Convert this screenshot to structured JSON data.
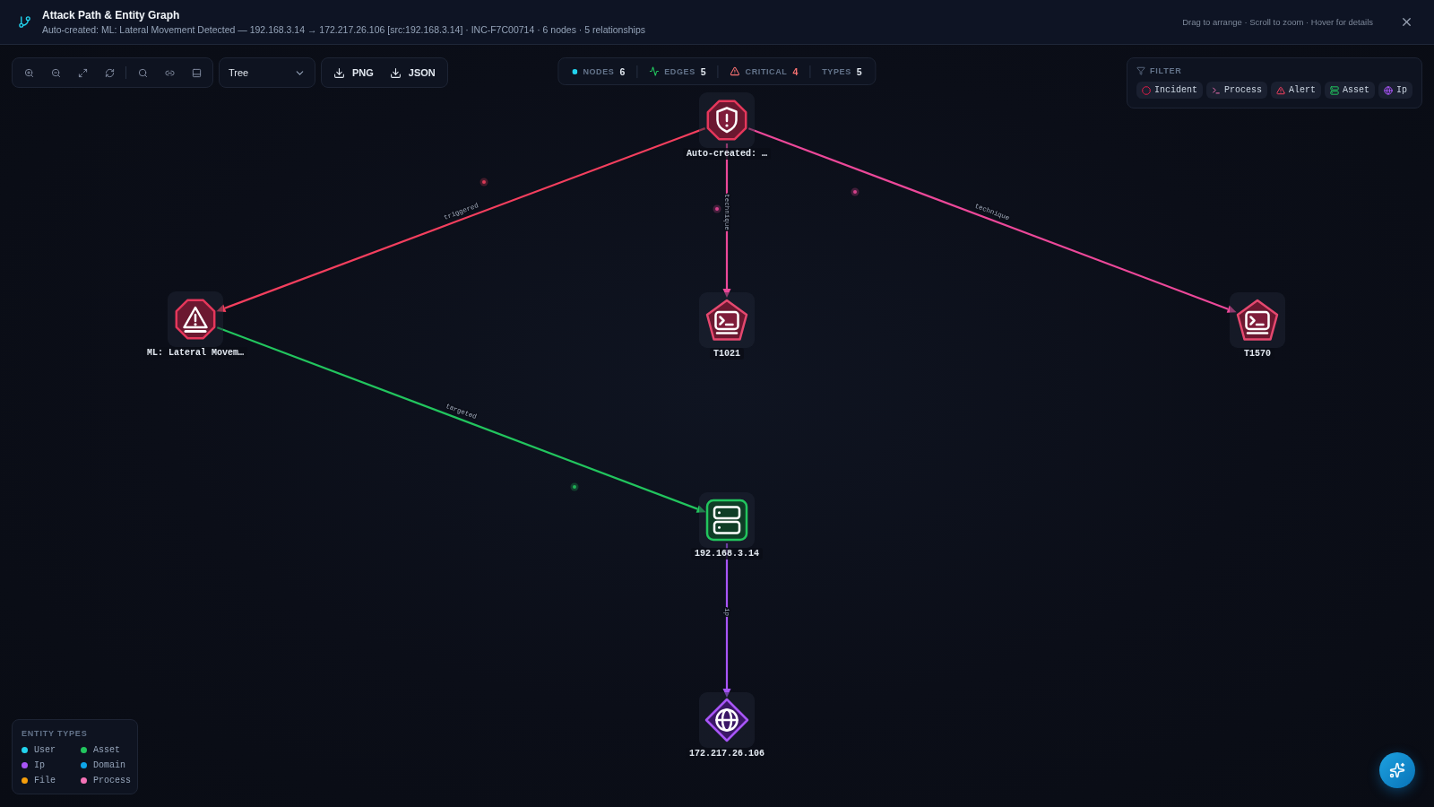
{
  "header": {
    "title": "Attack Path & Entity Graph",
    "subtitle": "Auto-created: ML: Lateral Movement Detected — 192.168.3.14 → 172.217.26.106 [src:192.168.3.14] · INC-F7C00714 · 6 nodes · 5 relationships",
    "hint": "Drag to arrange · Scroll to zoom · Hover for details"
  },
  "toolbar": {
    "layout": "Tree",
    "exports": [
      "PNG",
      "JSON"
    ]
  },
  "stats": [
    {
      "kind": "dot",
      "label": "NODES",
      "value": "6"
    },
    {
      "kind": "pulse",
      "label": "EDGES",
      "value": "5"
    },
    {
      "kind": "warning",
      "label": "CRITICAL",
      "value": "4"
    },
    {
      "kind": "plain",
      "label": "TYPES",
      "value": "5"
    }
  ],
  "filter": {
    "title": "FILTER",
    "chips": [
      {
        "kind": "incident",
        "label": "Incident"
      },
      {
        "kind": "process",
        "label": "Process"
      },
      {
        "kind": "alert",
        "label": "Alert"
      },
      {
        "kind": "asset",
        "label": "Asset"
      },
      {
        "kind": "ip",
        "label": "Ip"
      }
    ]
  },
  "graph": {
    "root": {
      "kind": "incident",
      "label": "Auto-created: …",
      "children": [
        {
          "kind": "alert",
          "label": "ML: Lateral Movem…",
          "edge": {
            "label": "triggered",
            "color": "#f43f5e"
          },
          "children": [
            {
              "kind": "asset",
              "label": "192.168.3.14",
              "edge": {
                "label": "targeted",
                "color": "#22c55e"
              },
              "children": [
                {
                  "kind": "ip",
                  "label": "172.217.26.106",
                  "edge": {
                    "label": "ip",
                    "color": "#a855f7"
                  }
                }
              ]
            }
          ]
        },
        {
          "kind": "process",
          "label": "T1021",
          "edge": {
            "label": "technique",
            "color": "#ec4899"
          }
        },
        {
          "kind": "process",
          "label": "T1570",
          "edge": {
            "label": "technique",
            "color": "#ec4899"
          }
        }
      ]
    }
  },
  "legend": {
    "title": "ENTITY TYPES",
    "items": [
      {
        "label": "User",
        "color": "#22d3ee"
      },
      {
        "label": "Asset",
        "color": "#22c55e"
      },
      {
        "label": "Ip",
        "color": "#a855f7"
      },
      {
        "label": "Domain",
        "color": "#0ea5e9"
      },
      {
        "label": "File",
        "color": "#f59e0b"
      },
      {
        "label": "Process",
        "color": "#f472b6"
      }
    ]
  }
}
